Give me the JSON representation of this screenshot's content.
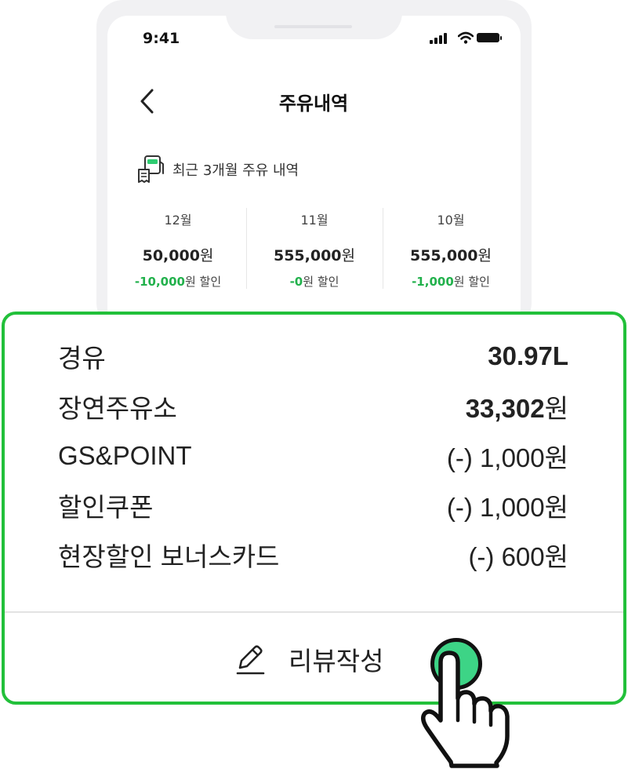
{
  "status_bar": {
    "time": "9:41"
  },
  "header": {
    "title": "주유내역"
  },
  "recent": {
    "label": "최근 3개월 주유 내역"
  },
  "months": [
    {
      "month": "12월",
      "amount": "50,000",
      "amount_unit": "원",
      "discount": "-10,000",
      "discount_suffix": "원 할인"
    },
    {
      "month": "11월",
      "amount": "555,000",
      "amount_unit": "원",
      "discount": "-0",
      "discount_suffix": "원 할인"
    },
    {
      "month": "10월",
      "amount": "555,000",
      "amount_unit": "원",
      "discount": "-1,000",
      "discount_suffix": "원 할인"
    }
  ],
  "detail": {
    "rows": [
      {
        "label": "경유",
        "value": "30.97L"
      },
      {
        "label": "장연주유소",
        "value": "33,302",
        "unit": "원"
      },
      {
        "label": "GS&POINT",
        "value": "(-) 1,000원"
      },
      {
        "label": "할인쿠폰",
        "value": "(-) 1,000원"
      },
      {
        "label": "현장할인 보너스카드",
        "value": "(-) 600원"
      }
    ],
    "review_button": "리뷰작성"
  },
  "colors": {
    "highlight": "#22c03a",
    "accent_green": "#22b14c",
    "tap": "#3dd486"
  },
  "icons": [
    "back-icon",
    "fuel-pump-icon",
    "pencil-icon",
    "hand-pointer-icon"
  ]
}
